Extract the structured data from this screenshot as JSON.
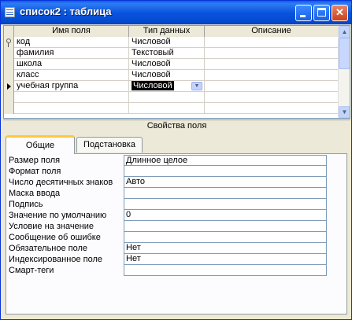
{
  "window": {
    "title": "список2 : таблица",
    "buttons": {
      "minimize": "minimize",
      "maximize": "maximize",
      "close": "✕"
    }
  },
  "grid": {
    "columns": [
      "Имя поля",
      "Тип данных",
      "Описание"
    ],
    "rows": [
      {
        "name": "код",
        "type": "Числовой",
        "description": "",
        "marker": "key-icon"
      },
      {
        "name": "фамилия",
        "type": "Текстовый",
        "description": "",
        "marker": ""
      },
      {
        "name": "школа",
        "type": "Числовой",
        "description": "",
        "marker": ""
      },
      {
        "name": "класс",
        "type": "Числовой",
        "description": "",
        "marker": ""
      },
      {
        "name": "учебная группа",
        "type": "Числовой",
        "description": "",
        "marker": "current-row-arrow-icon"
      }
    ]
  },
  "properties": {
    "title": "Свойства поля",
    "tabs": [
      "Общие",
      "Подстановка"
    ],
    "active_tab": "Общие",
    "items": [
      {
        "label": "Размер поля",
        "value": "Длинное целое"
      },
      {
        "label": "Формат поля",
        "value": ""
      },
      {
        "label": "Число десятичных знаков",
        "value": "Авто"
      },
      {
        "label": "Маска ввода",
        "value": ""
      },
      {
        "label": "Подпись",
        "value": ""
      },
      {
        "label": "Значение по умолчанию",
        "value": "0"
      },
      {
        "label": "Условие на значение",
        "value": ""
      },
      {
        "label": "Сообщение об ошибке",
        "value": ""
      },
      {
        "label": "Обязательное поле",
        "value": "Нет"
      },
      {
        "label": "Индексированное поле",
        "value": "Нет"
      },
      {
        "label": "Смарт-теги",
        "value": ""
      }
    ]
  },
  "colors": {
    "titlebar": "#0a55de",
    "selection": "#000000",
    "tab_highlight": "#ffc83c"
  }
}
